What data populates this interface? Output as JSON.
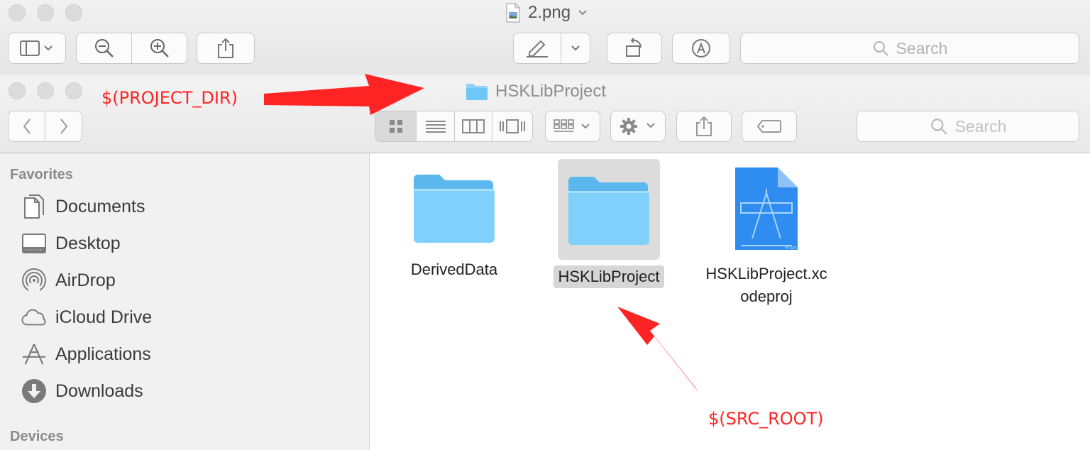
{
  "preview": {
    "title": "2.png",
    "search_placeholder": "Search"
  },
  "finder": {
    "title": "HSKLibProject",
    "search_placeholder": "Search",
    "sidebar": {
      "favorites_header": "Favorites",
      "items": [
        {
          "label": "Documents",
          "icon": "documents-icon"
        },
        {
          "label": "Desktop",
          "icon": "desktop-icon"
        },
        {
          "label": "AirDrop",
          "icon": "airdrop-icon"
        },
        {
          "label": "iCloud Drive",
          "icon": "cloud-icon"
        },
        {
          "label": "Applications",
          "icon": "applications-icon"
        },
        {
          "label": "Downloads",
          "icon": "downloads-icon"
        }
      ],
      "devices_header": "Devices"
    },
    "files": [
      {
        "name": "DerivedData",
        "icon": "folder-icon"
      },
      {
        "name": "HSKLibProject",
        "icon": "folder-icon",
        "selected": true
      },
      {
        "name_line1": "HSKLibProject.xc",
        "name_line2": "odeproj",
        "icon": "xcodeproj-icon"
      }
    ]
  },
  "annotations": {
    "project_dir": "$(PROJECT_DIR)",
    "src_root": "$(SRC_ROOT)",
    "color": "#ff2424"
  },
  "colors": {
    "folder_blue": "#6ec8f7",
    "selection_bg": "#dcdcdc",
    "xcode_blue": "#2f8cf0"
  }
}
